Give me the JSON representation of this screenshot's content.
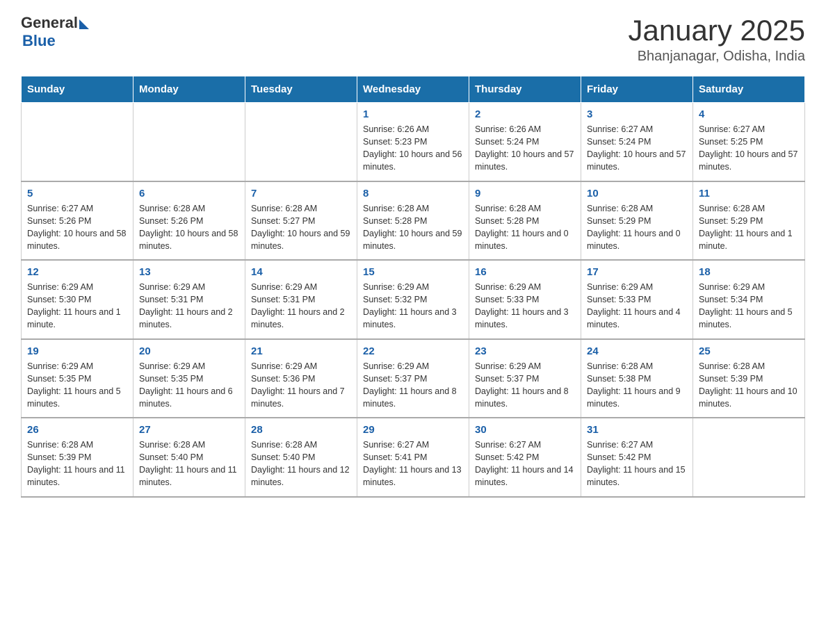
{
  "header": {
    "logo_general": "General",
    "logo_blue": "Blue",
    "month_title": "January 2025",
    "location": "Bhanjanagar, Odisha, India"
  },
  "days_of_week": [
    "Sunday",
    "Monday",
    "Tuesday",
    "Wednesday",
    "Thursday",
    "Friday",
    "Saturday"
  ],
  "weeks": [
    [
      {
        "day": "",
        "info": ""
      },
      {
        "day": "",
        "info": ""
      },
      {
        "day": "",
        "info": ""
      },
      {
        "day": "1",
        "info": "Sunrise: 6:26 AM\nSunset: 5:23 PM\nDaylight: 10 hours and 56 minutes."
      },
      {
        "day": "2",
        "info": "Sunrise: 6:26 AM\nSunset: 5:24 PM\nDaylight: 10 hours and 57 minutes."
      },
      {
        "day": "3",
        "info": "Sunrise: 6:27 AM\nSunset: 5:24 PM\nDaylight: 10 hours and 57 minutes."
      },
      {
        "day": "4",
        "info": "Sunrise: 6:27 AM\nSunset: 5:25 PM\nDaylight: 10 hours and 57 minutes."
      }
    ],
    [
      {
        "day": "5",
        "info": "Sunrise: 6:27 AM\nSunset: 5:26 PM\nDaylight: 10 hours and 58 minutes."
      },
      {
        "day": "6",
        "info": "Sunrise: 6:28 AM\nSunset: 5:26 PM\nDaylight: 10 hours and 58 minutes."
      },
      {
        "day": "7",
        "info": "Sunrise: 6:28 AM\nSunset: 5:27 PM\nDaylight: 10 hours and 59 minutes."
      },
      {
        "day": "8",
        "info": "Sunrise: 6:28 AM\nSunset: 5:28 PM\nDaylight: 10 hours and 59 minutes."
      },
      {
        "day": "9",
        "info": "Sunrise: 6:28 AM\nSunset: 5:28 PM\nDaylight: 11 hours and 0 minutes."
      },
      {
        "day": "10",
        "info": "Sunrise: 6:28 AM\nSunset: 5:29 PM\nDaylight: 11 hours and 0 minutes."
      },
      {
        "day": "11",
        "info": "Sunrise: 6:28 AM\nSunset: 5:29 PM\nDaylight: 11 hours and 1 minute."
      }
    ],
    [
      {
        "day": "12",
        "info": "Sunrise: 6:29 AM\nSunset: 5:30 PM\nDaylight: 11 hours and 1 minute."
      },
      {
        "day": "13",
        "info": "Sunrise: 6:29 AM\nSunset: 5:31 PM\nDaylight: 11 hours and 2 minutes."
      },
      {
        "day": "14",
        "info": "Sunrise: 6:29 AM\nSunset: 5:31 PM\nDaylight: 11 hours and 2 minutes."
      },
      {
        "day": "15",
        "info": "Sunrise: 6:29 AM\nSunset: 5:32 PM\nDaylight: 11 hours and 3 minutes."
      },
      {
        "day": "16",
        "info": "Sunrise: 6:29 AM\nSunset: 5:33 PM\nDaylight: 11 hours and 3 minutes."
      },
      {
        "day": "17",
        "info": "Sunrise: 6:29 AM\nSunset: 5:33 PM\nDaylight: 11 hours and 4 minutes."
      },
      {
        "day": "18",
        "info": "Sunrise: 6:29 AM\nSunset: 5:34 PM\nDaylight: 11 hours and 5 minutes."
      }
    ],
    [
      {
        "day": "19",
        "info": "Sunrise: 6:29 AM\nSunset: 5:35 PM\nDaylight: 11 hours and 5 minutes."
      },
      {
        "day": "20",
        "info": "Sunrise: 6:29 AM\nSunset: 5:35 PM\nDaylight: 11 hours and 6 minutes."
      },
      {
        "day": "21",
        "info": "Sunrise: 6:29 AM\nSunset: 5:36 PM\nDaylight: 11 hours and 7 minutes."
      },
      {
        "day": "22",
        "info": "Sunrise: 6:29 AM\nSunset: 5:37 PM\nDaylight: 11 hours and 8 minutes."
      },
      {
        "day": "23",
        "info": "Sunrise: 6:29 AM\nSunset: 5:37 PM\nDaylight: 11 hours and 8 minutes."
      },
      {
        "day": "24",
        "info": "Sunrise: 6:28 AM\nSunset: 5:38 PM\nDaylight: 11 hours and 9 minutes."
      },
      {
        "day": "25",
        "info": "Sunrise: 6:28 AM\nSunset: 5:39 PM\nDaylight: 11 hours and 10 minutes."
      }
    ],
    [
      {
        "day": "26",
        "info": "Sunrise: 6:28 AM\nSunset: 5:39 PM\nDaylight: 11 hours and 11 minutes."
      },
      {
        "day": "27",
        "info": "Sunrise: 6:28 AM\nSunset: 5:40 PM\nDaylight: 11 hours and 11 minutes."
      },
      {
        "day": "28",
        "info": "Sunrise: 6:28 AM\nSunset: 5:40 PM\nDaylight: 11 hours and 12 minutes."
      },
      {
        "day": "29",
        "info": "Sunrise: 6:27 AM\nSunset: 5:41 PM\nDaylight: 11 hours and 13 minutes."
      },
      {
        "day": "30",
        "info": "Sunrise: 6:27 AM\nSunset: 5:42 PM\nDaylight: 11 hours and 14 minutes."
      },
      {
        "day": "31",
        "info": "Sunrise: 6:27 AM\nSunset: 5:42 PM\nDaylight: 11 hours and 15 minutes."
      },
      {
        "day": "",
        "info": ""
      }
    ]
  ]
}
